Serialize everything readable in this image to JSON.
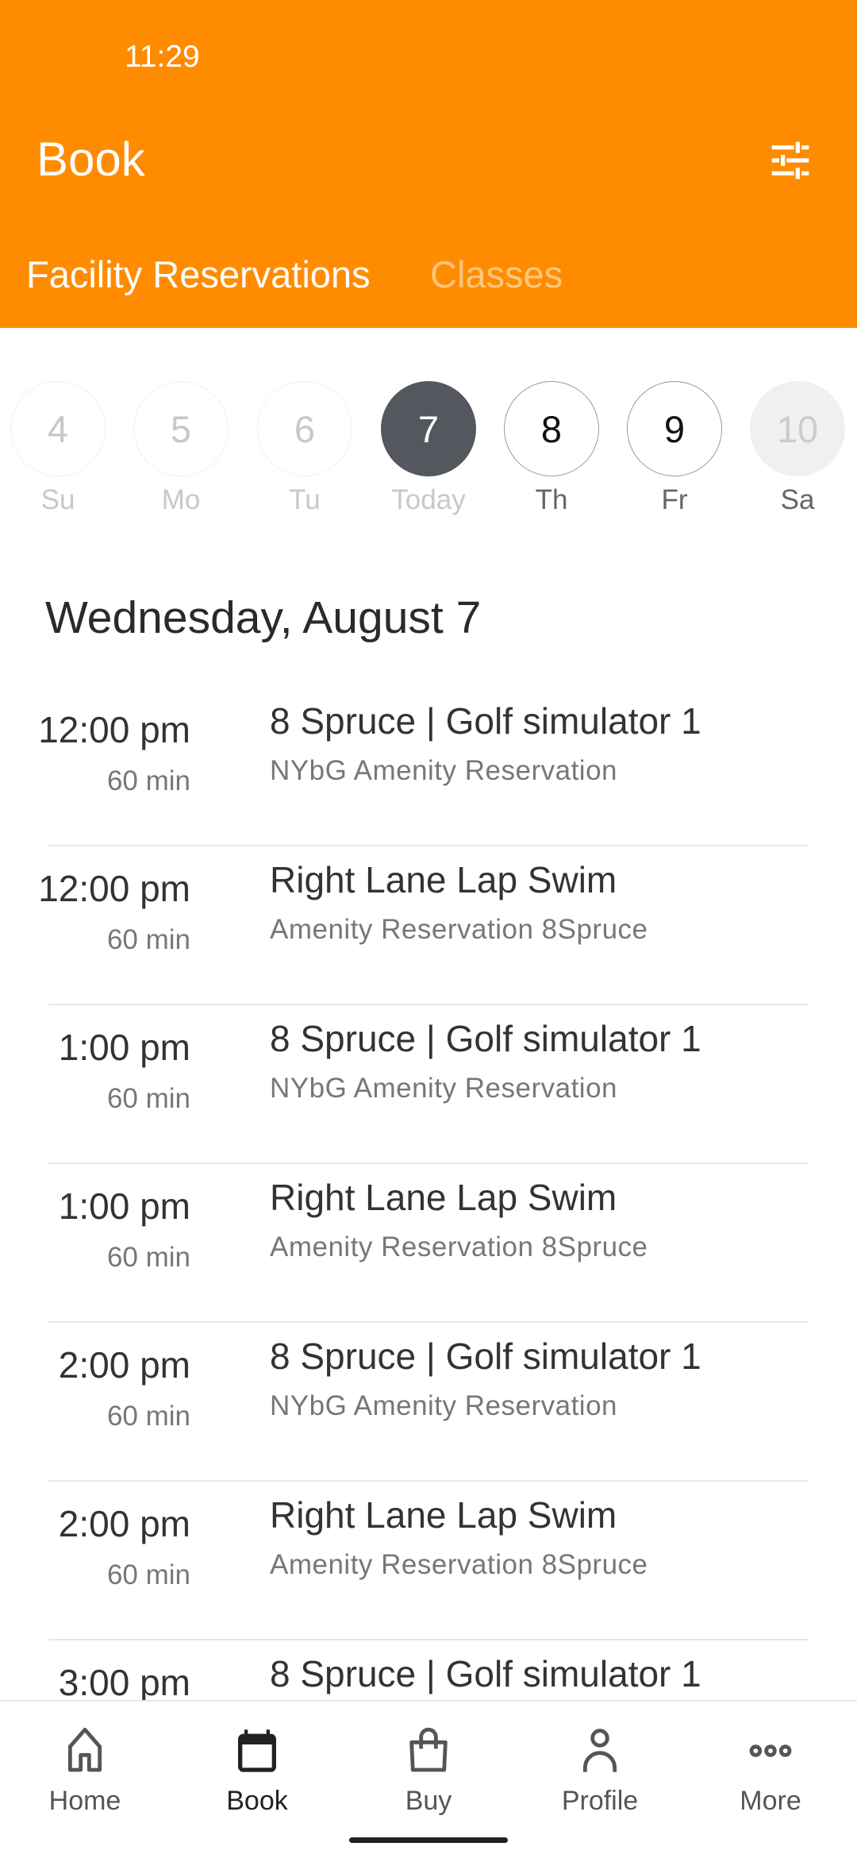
{
  "status_bar": {
    "time": "11:29"
  },
  "header": {
    "title": "Book",
    "filter_icon": "sliders-icon",
    "accent": "#FF8C00"
  },
  "tabs": [
    {
      "label": "Facility Reservations",
      "active": true
    },
    {
      "label": "Classes",
      "active": false
    }
  ],
  "days": [
    {
      "num": "4",
      "label": "Su",
      "state": "past"
    },
    {
      "num": "5",
      "label": "Mo",
      "state": "past"
    },
    {
      "num": "6",
      "label": "Tu",
      "state": "past"
    },
    {
      "num": "7",
      "label": "Today",
      "state": "selected"
    },
    {
      "num": "8",
      "label": "Th",
      "state": "available"
    },
    {
      "num": "9",
      "label": "Fr",
      "state": "available"
    },
    {
      "num": "10",
      "label": "Sa",
      "state": "disabled"
    }
  ],
  "date_heading": "Wednesday, August 7",
  "reservations": [
    {
      "time": "12:00 pm",
      "duration": "60 min",
      "name": "8 Spruce | Golf simulator 1",
      "subtitle": "NYbG Amenity Reservation"
    },
    {
      "time": "12:00 pm",
      "duration": "60 min",
      "name": "Right Lane Lap Swim",
      "subtitle": "Amenity Reservation 8Spruce"
    },
    {
      "time": "1:00 pm",
      "duration": "60 min",
      "name": "8 Spruce | Golf simulator 1",
      "subtitle": "NYbG Amenity Reservation"
    },
    {
      "time": "1:00 pm",
      "duration": "60 min",
      "name": "Right Lane Lap Swim",
      "subtitle": "Amenity Reservation 8Spruce"
    },
    {
      "time": "2:00 pm",
      "duration": "60 min",
      "name": "8 Spruce | Golf simulator 1",
      "subtitle": "NYbG Amenity Reservation"
    },
    {
      "time": "2:00 pm",
      "duration": "60 min",
      "name": "Right Lane Lap Swim",
      "subtitle": "Amenity Reservation 8Spruce"
    },
    {
      "time": "3:00 pm",
      "duration": "",
      "name": "8 Spruce | Golf simulator 1",
      "subtitle": ""
    }
  ],
  "bottom_nav": [
    {
      "label": "Home",
      "icon": "home-icon"
    },
    {
      "label": "Book",
      "icon": "calendar-icon",
      "active": true
    },
    {
      "label": "Buy",
      "icon": "shopping-bag-icon"
    },
    {
      "label": "Profile",
      "icon": "person-icon"
    },
    {
      "label": "More",
      "icon": "more-dots-icon"
    }
  ]
}
